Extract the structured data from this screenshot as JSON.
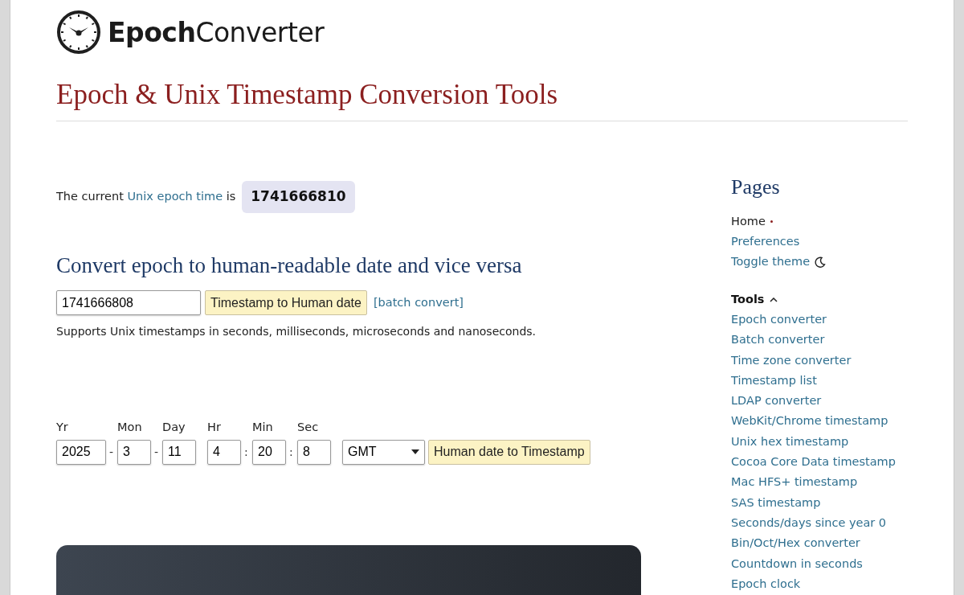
{
  "logo": {
    "bold": "Epoch",
    "regular": "Converter"
  },
  "title": "Epoch & Unix Timestamp Conversion Tools",
  "current": {
    "prefix": "The current",
    "link": "Unix epoch time",
    "suffix": "is",
    "value": "1741666810"
  },
  "converter": {
    "heading": "Convert epoch to human-readable date and vice versa",
    "timestamp": "1741666808",
    "button": "Timestamp to Human date",
    "batch_link": "[batch convert]",
    "note": "Supports Unix timestamps in seconds, milliseconds, microseconds and nanoseconds."
  },
  "date_form": {
    "fields": [
      {
        "label": "Yr",
        "value": "2025",
        "sep": "-"
      },
      {
        "label": "Mon",
        "value": "3",
        "sep": "-"
      },
      {
        "label": "Day",
        "value": "11"
      },
      {
        "label": "Hr",
        "value": "4",
        "sep": ":"
      },
      {
        "label": "Min",
        "value": "20",
        "sep": ":"
      },
      {
        "label": "Sec",
        "value": "8"
      }
    ],
    "timezone": "GMT",
    "button": "Human date to Timestamp"
  },
  "sidebar": {
    "heading": "Pages",
    "pages": [
      {
        "label": "Home",
        "selected": true
      },
      {
        "label": "Preferences",
        "selected": false
      },
      {
        "label": "Toggle theme",
        "selected": false,
        "kind": "theme"
      }
    ],
    "tools": {
      "label": "Tools",
      "expanded": true,
      "items": [
        "Epoch converter",
        "Batch converter",
        "Time zone converter",
        "Timestamp list",
        "LDAP converter",
        "WebKit/Chrome timestamp",
        "Unix hex timestamp",
        "Cocoa Core Data timestamp",
        "Mac HFS+ timestamp",
        "SAS timestamp",
        "Seconds/days since year 0",
        "Bin/Oct/Hex converter",
        "Countdown in seconds",
        "Epoch clock"
      ]
    }
  },
  "promo": {
    "kind": "dark-card"
  }
}
